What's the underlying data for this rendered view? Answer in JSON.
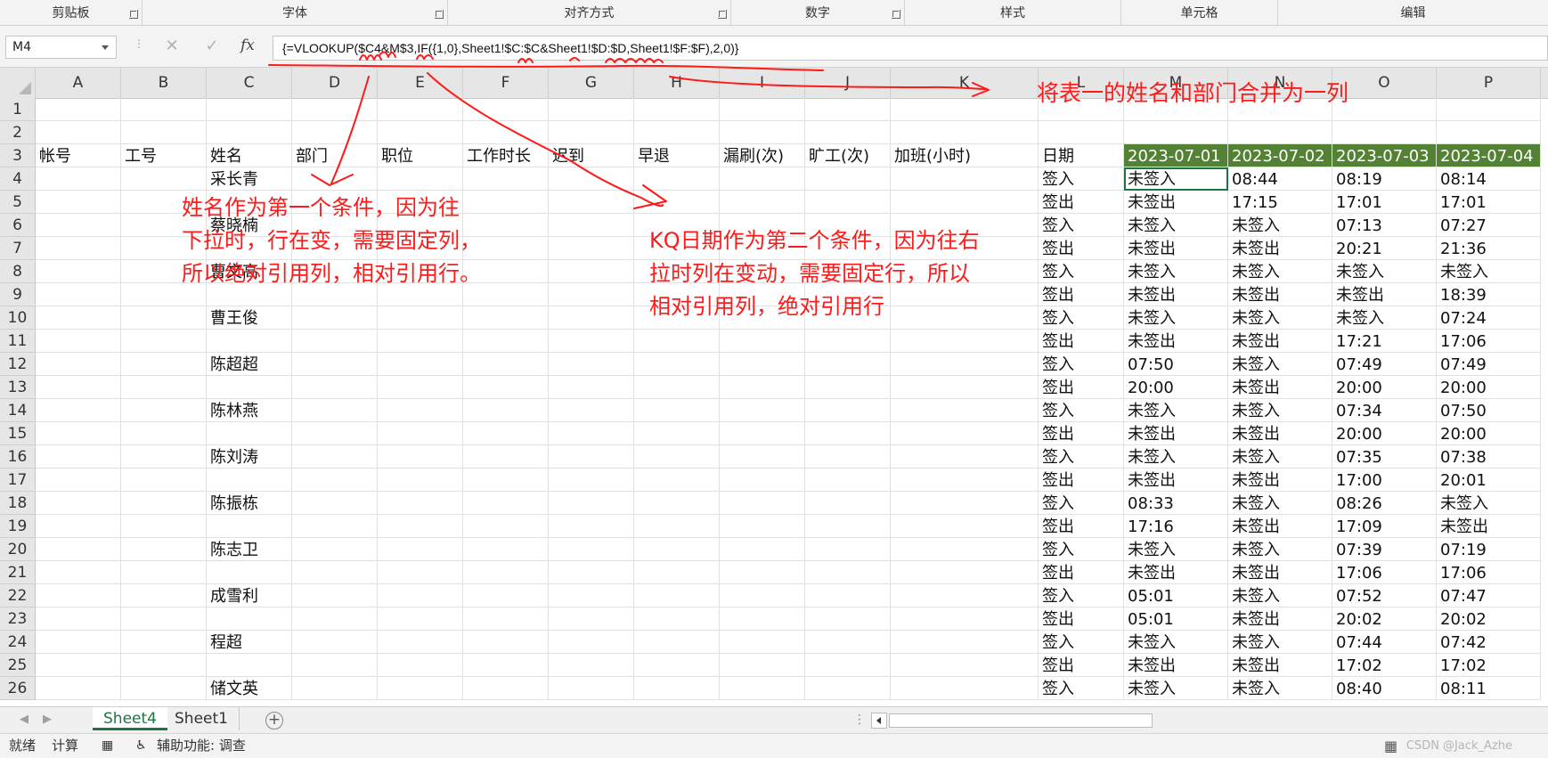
{
  "ribbon": {
    "groups": [
      {
        "label": "剪贴板"
      },
      {
        "label": "字体"
      },
      {
        "label": "对齐方式"
      },
      {
        "label": "数字"
      },
      {
        "label": "样式"
      },
      {
        "label": "单元格"
      },
      {
        "label": "编辑"
      }
    ]
  },
  "formula_bar": {
    "name_box": "M4",
    "formula": "{=VLOOKUP($C4&M$3,IF({1,0},Sheet1!$C:$C&Sheet1!$D:$D,Sheet1!$F:$F),2,0)}",
    "cancel_icon": "✕",
    "enter_icon": "✓",
    "fx_label": "fx"
  },
  "columns": [
    "A",
    "B",
    "C",
    "D",
    "E",
    "F",
    "G",
    "H",
    "I",
    "J",
    "K",
    "L",
    "M",
    "N",
    "O",
    "P"
  ],
  "rows": [
    {
      "num": "1",
      "cells": {}
    },
    {
      "num": "2",
      "cells": {}
    },
    {
      "num": "3",
      "cells": {
        "A": "帐号",
        "B": "工号",
        "C": "姓名",
        "D": "部门",
        "E": "职位",
        "F": "工作时长",
        "G": "迟到",
        "H": "早退",
        "I": "漏刷(次)",
        "J": "旷工(次)",
        "K": "加班(小时)",
        "L": "日期",
        "M": "2023-07-01",
        "N": "2023-07-02",
        "O": "2023-07-03",
        "P": "2023-07-04"
      }
    },
    {
      "num": "4",
      "cells": {
        "C": "采长青",
        "L": "签入",
        "M": "未签入",
        "N": "08:44",
        "O": "08:19",
        "P": "08:14"
      }
    },
    {
      "num": "5",
      "cells": {
        "L": "签出",
        "M": "未签出",
        "N": "17:15",
        "O": "17:01",
        "P": "17:01"
      }
    },
    {
      "num": "6",
      "cells": {
        "C": "蔡晓楠",
        "L": "签入",
        "M": "未签入",
        "N": "未签入",
        "O": "07:13",
        "P": "07:27"
      }
    },
    {
      "num": "7",
      "cells": {
        "L": "签出",
        "M": "未签出",
        "N": "未签出",
        "O": "20:21",
        "P": "21:36"
      }
    },
    {
      "num": "8",
      "cells": {
        "C": "曹文高",
        "L": "签入",
        "M": "未签入",
        "N": "未签入",
        "O": "未签入",
        "P": "未签入"
      }
    },
    {
      "num": "9",
      "cells": {
        "L": "签出",
        "M": "未签出",
        "N": "未签出",
        "O": "未签出",
        "P": "18:39"
      }
    },
    {
      "num": "10",
      "cells": {
        "C": "曹王俊",
        "L": "签入",
        "M": "未签入",
        "N": "未签入",
        "O": "未签入",
        "P": "07:24"
      }
    },
    {
      "num": "11",
      "cells": {
        "L": "签出",
        "M": "未签出",
        "N": "未签出",
        "O": "17:21",
        "P": "17:06"
      }
    },
    {
      "num": "12",
      "cells": {
        "C": "陈超超",
        "L": "签入",
        "M": "07:50",
        "N": "未签入",
        "O": "07:49",
        "P": "07:49"
      }
    },
    {
      "num": "13",
      "cells": {
        "L": "签出",
        "M": "20:00",
        "N": "未签出",
        "O": "20:00",
        "P": "20:00"
      }
    },
    {
      "num": "14",
      "cells": {
        "C": "陈林燕",
        "L": "签入",
        "M": "未签入",
        "N": "未签入",
        "O": "07:34",
        "P": "07:50"
      }
    },
    {
      "num": "15",
      "cells": {
        "L": "签出",
        "M": "未签出",
        "N": "未签出",
        "O": "20:00",
        "P": "20:00"
      }
    },
    {
      "num": "16",
      "cells": {
        "C": "陈刘涛",
        "L": "签入",
        "M": "未签入",
        "N": "未签入",
        "O": "07:35",
        "P": "07:38"
      }
    },
    {
      "num": "17",
      "cells": {
        "L": "签出",
        "M": "未签出",
        "N": "未签出",
        "O": "17:00",
        "P": "20:01"
      }
    },
    {
      "num": "18",
      "cells": {
        "C": "陈振栋",
        "L": "签入",
        "M": "08:33",
        "N": "未签入",
        "O": "08:26",
        "P": "未签入"
      }
    },
    {
      "num": "19",
      "cells": {
        "L": "签出",
        "M": "17:16",
        "N": "未签出",
        "O": "17:09",
        "P": "未签出"
      }
    },
    {
      "num": "20",
      "cells": {
        "C": "陈志卫",
        "L": "签入",
        "M": "未签入",
        "N": "未签入",
        "O": "07:39",
        "P": "07:19"
      }
    },
    {
      "num": "21",
      "cells": {
        "L": "签出",
        "M": "未签出",
        "N": "未签出",
        "O": "17:06",
        "P": "17:06"
      }
    },
    {
      "num": "22",
      "cells": {
        "C": "成雪利",
        "L": "签入",
        "M": "05:01",
        "N": "未签入",
        "O": "07:52",
        "P": "07:47"
      }
    },
    {
      "num": "23",
      "cells": {
        "L": "签出",
        "M": "05:01",
        "N": "未签出",
        "O": "20:02",
        "P": "20:02"
      }
    },
    {
      "num": "24",
      "cells": {
        "C": "程超",
        "L": "签入",
        "M": "未签入",
        "N": "未签入",
        "O": "07:44",
        "P": "07:42"
      }
    },
    {
      "num": "25",
      "cells": {
        "L": "签出",
        "M": "未签出",
        "N": "未签出",
        "O": "17:02",
        "P": "17:02"
      }
    },
    {
      "num": "26",
      "cells": {
        "C": "储文英",
        "L": "签入",
        "M": "未签入",
        "N": "未签入",
        "O": "08:40",
        "P": "08:11"
      }
    }
  ],
  "annotations": {
    "merge_note": "将表一的姓名和部门合并为一列",
    "name_note_lines": [
      "姓名作为第一个条件，因为往",
      "下拉时，行在变，需要固定列，",
      "所以绝对引用列，相对引用行。"
    ],
    "date_note_lines": [
      "KQ日期作为第二个条件，因为往右",
      "拉时列在变动，需要固定行，所以",
      "相对引用列，绝对引用行"
    ],
    "color": "#ff1a1a"
  },
  "sheet_tabs": [
    {
      "label": "Sheet4",
      "active": true
    },
    {
      "label": "Sheet1",
      "active": false
    }
  ],
  "status_bar": {
    "ready": "就绪",
    "calc": "计算",
    "accessibility": "辅助功能: 调查",
    "watermark": "CSDN @Jack_Azhe"
  },
  "colors": {
    "accent": "#217346",
    "header_green": "#548235"
  }
}
